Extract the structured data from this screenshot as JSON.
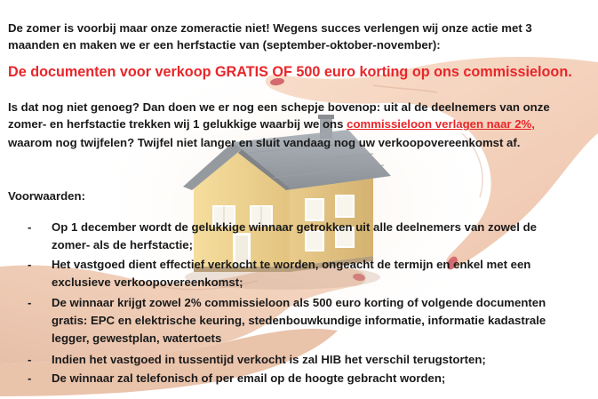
{
  "intro": {
    "line1": "De zomer is voorbij maar onze zomeractie niet! Wegens succes verlengen wij onze actie met 3",
    "line2": "maanden en maken we er een herfstactie van (september-oktober-november):"
  },
  "headline": "De documenten voor verkoop GRATIS OF 500 euro korting op ons commissieloon.",
  "bonus": {
    "line1": "Is dat nog niet genoeg? Dan doen we er nog een schepje bovenop: uit al de deelnemers van onze",
    "line2_before": "zomer- en herfstactie trekken wij 1 gelukkige waarbij we ons ",
    "line2_highlight": "commissieloon verlagen naar 2%,",
    "line3": "waarom nog twijfelen? Twijfel niet langer en sluit vandaag nog uw verkoopovereenkomst af."
  },
  "conditions": {
    "heading": "Voorwaarden:",
    "dash": "-",
    "items": [
      {
        "line1": "Op 1 december wordt de gelukkige winnaar getrokken uit alle deelnemers van zowel de",
        "line2": "zomer- als de herfstactie;"
      },
      {
        "line1": "Het vastgoed dient effectief verkocht te worden, ongeacht de termijn en enkel met een",
        "line2": "exclusieve verkoopovereenkomst;"
      },
      {
        "line1": "De winnaar krijgt zowel 2% commissieloon als 500 euro korting of volgende documenten",
        "line2": "gratis: EPC en elektrische keuring, stedenbouwkundige informatie, informatie kadastrale",
        "line3": "legger, gewestplan, watertoets"
      },
      {
        "line1": "Indien het vastgoed in tussentijd verkocht is zal HIB het verschil terugstorten;"
      },
      {
        "line1": "De winnaar zal telefonisch of per email op de hoogte gebracht worden;"
      }
    ]
  },
  "colors": {
    "headline_red": "#e8262a",
    "body_text": "#1a1a1a",
    "background": "#ffffff"
  },
  "illustration": {
    "subject": "hands holding a model house",
    "icons": [
      "house-icon",
      "hand-icon"
    ]
  }
}
